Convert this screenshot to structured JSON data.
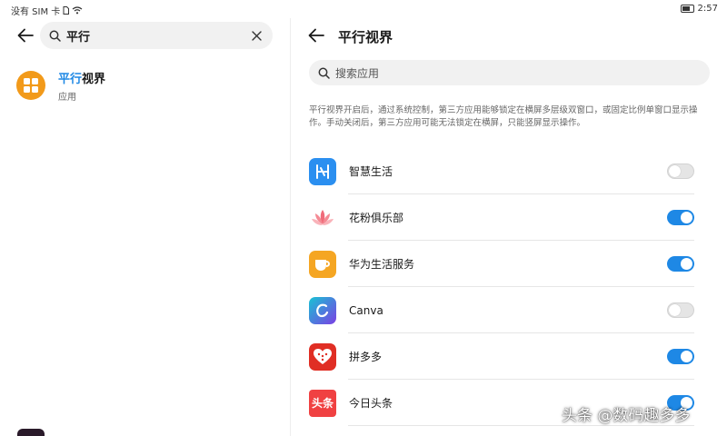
{
  "status_bar": {
    "carrier": "没有 SIM 卡",
    "time": "2:57",
    "battery": "65"
  },
  "left": {
    "search_value": "平行",
    "result": {
      "title_highlight": "平行",
      "title_rest": "视界",
      "subtitle": "应用"
    }
  },
  "right": {
    "title": "平行视界",
    "search_placeholder": "搜索应用",
    "description": "平行视界开启后，通过系统控制，第三方应用能够锁定在横屏多层级双窗口，或固定比例单窗口显示操作。手动关闭后，第三方应用可能无法锁定在横屏，只能竖屏显示操作。",
    "apps": [
      {
        "name": "智慧生活",
        "enabled": false,
        "icon": "smart-life-icon",
        "color": "#2b8ff0"
      },
      {
        "name": "花粉俱乐部",
        "enabled": true,
        "icon": "lotus-icon",
        "color": "#f06b7a"
      },
      {
        "name": "华为生活服务",
        "enabled": true,
        "icon": "cup-icon",
        "color": "#f5a623"
      },
      {
        "name": "Canva",
        "enabled": false,
        "icon": "canva-icon",
        "color": "#7b3fe4"
      },
      {
        "name": "拼多多",
        "enabled": true,
        "icon": "pinduoduo-icon",
        "color": "#e02e24"
      },
      {
        "name": "今日头条",
        "enabled": true,
        "icon": "toutiao-icon",
        "color": "#f04142"
      }
    ],
    "toutiao_label": "头条"
  },
  "watermark": "头条 @数码趣多多",
  "colors": {
    "accent": "#1e88e5",
    "result_icon": "#f29a1a"
  }
}
